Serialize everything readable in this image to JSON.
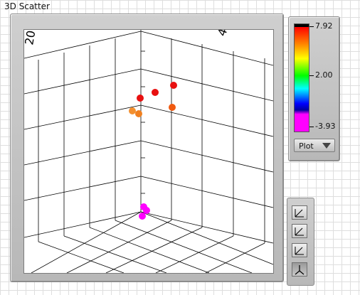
{
  "window": {
    "title": "3D Scatter"
  },
  "legend": {
    "max_label": "7.92",
    "mid_label": "2.00",
    "min_label": "-3.93",
    "plot_select": "Plot"
  },
  "plot": {
    "axis_labels": {
      "top_left": "20",
      "top_right": "4"
    }
  },
  "colors": {
    "red": "#e81010",
    "orange": "#f08020",
    "magenta": "#ff00ff"
  },
  "toolbar": {
    "tools": [
      {
        "name": "view-xy-icon"
      },
      {
        "name": "view-xz-icon"
      },
      {
        "name": "view-yz-icon"
      },
      {
        "name": "view-default-icon"
      }
    ]
  }
}
